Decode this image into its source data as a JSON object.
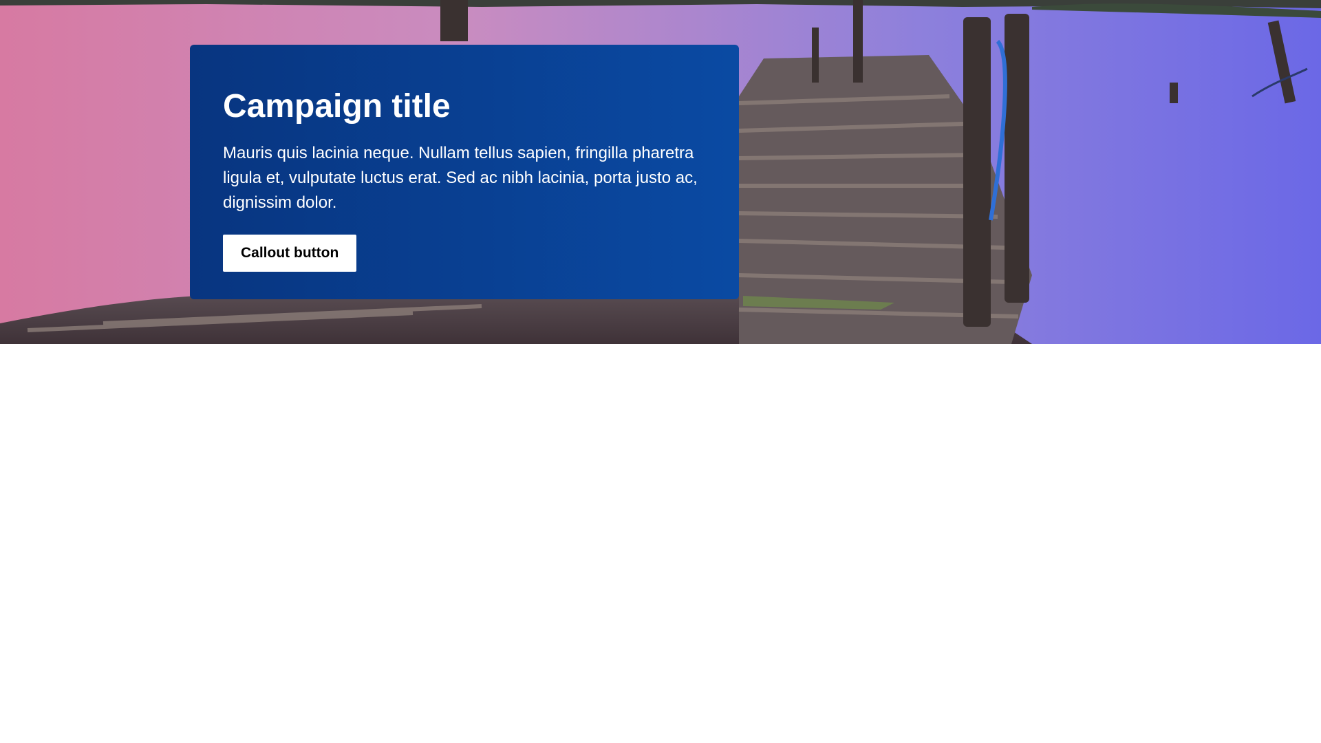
{
  "hero": {
    "image_name": "sunset-pier-image",
    "colors": {
      "sky_pink": "#d27aa8",
      "water_purple": "#a48ad6",
      "water_blue": "#6a6be8",
      "callout_dark": "#083580",
      "callout_light": "#0a4aa3"
    }
  },
  "callout": {
    "title": "Campaign title",
    "body": "Mauris quis lacinia neque. Nullam tellus sapien, fringilla pharetra ligula et, vulputate luctus erat. Sed ac nibh lacinia, porta justo ac, dignissim dolor.",
    "button_label": "Callout button"
  }
}
